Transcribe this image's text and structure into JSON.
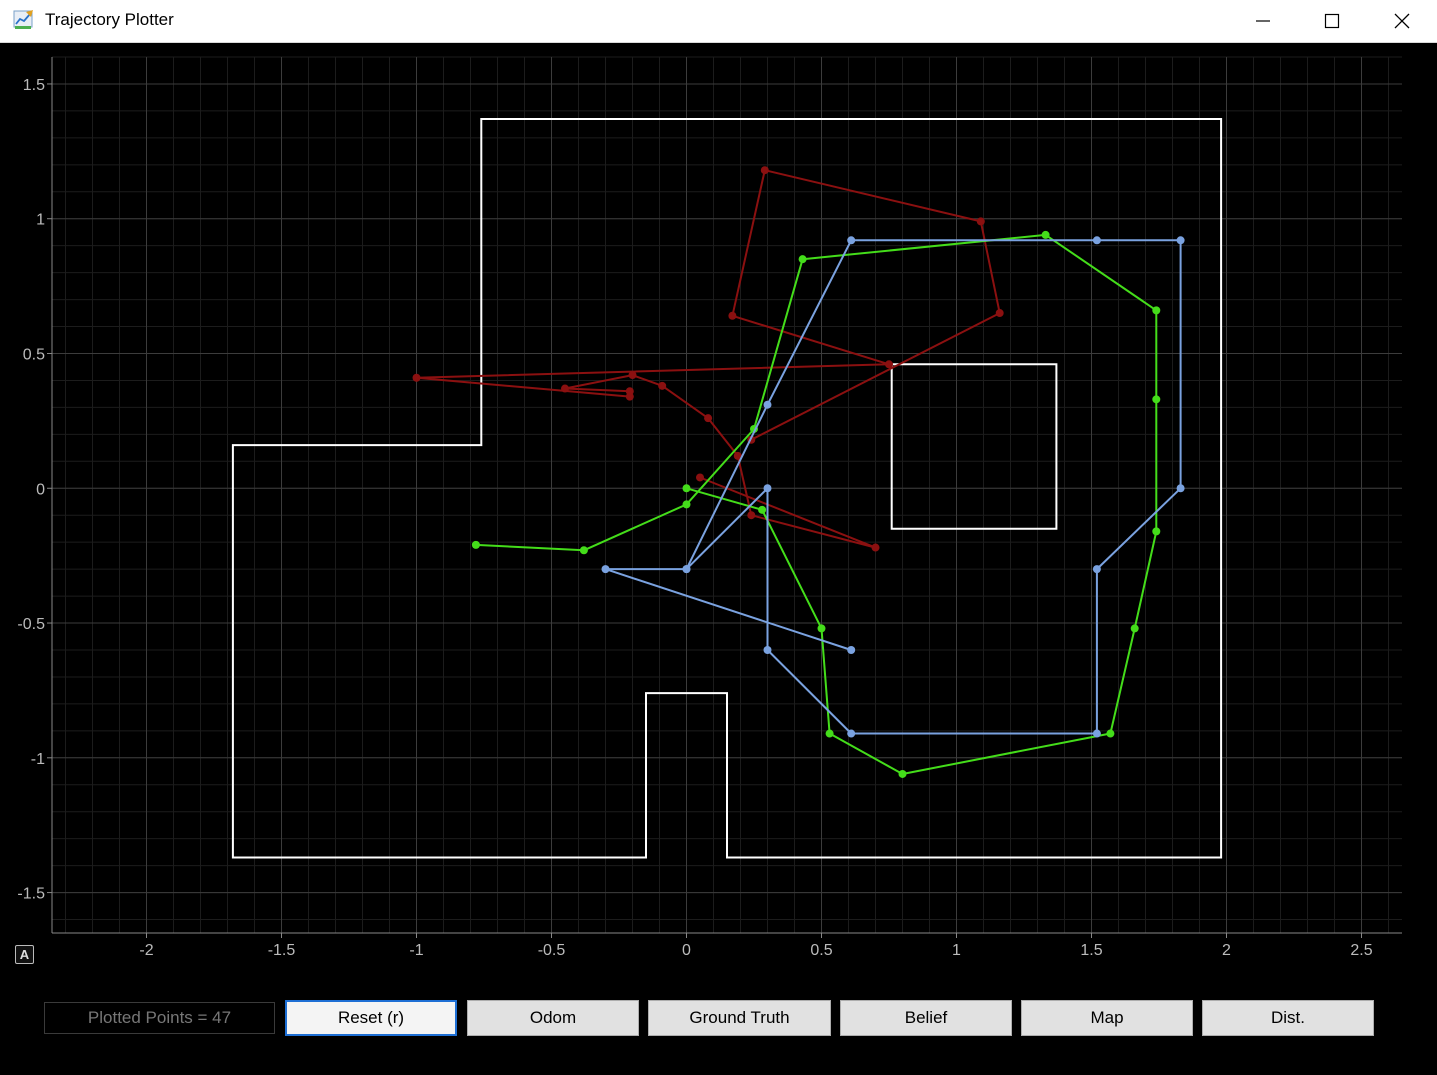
{
  "window": {
    "title": "Trajectory Plotter"
  },
  "toolbar": {
    "auto_label": "A",
    "status": "Plotted Points = 47",
    "buttons": [
      "Reset (r)",
      "Odom",
      "Ground Truth",
      "Belief",
      "Map",
      "Dist."
    ]
  },
  "colors": {
    "odom": "#8b1010",
    "ground_truth": "#44dd1a",
    "belief": "#7aa2e0",
    "map": "#ffffff",
    "background": "#000000"
  },
  "chart_data": {
    "type": "line",
    "xlim": [
      -2.35,
      2.65
    ],
    "ylim": [
      -1.65,
      1.6
    ],
    "x_ticks": [
      -2,
      -1.5,
      -1,
      -0.5,
      0,
      0.5,
      1,
      1.5,
      2,
      2.5
    ],
    "x_tick_labels": [
      "-2",
      "-1.5",
      "-1",
      "-0.5",
      "0",
      "0.5",
      "1",
      "1.5",
      "2",
      "2.5"
    ],
    "y_ticks": [
      1.5,
      1,
      0.5,
      0,
      -0.5,
      -1,
      -1.5
    ],
    "y_tick_labels": [
      "1.5",
      "1",
      "0.5",
      "0",
      "-0.5",
      "-1",
      "-1.5"
    ],
    "grid": true,
    "map_polygons": [
      [
        [
          -1.68,
          0.16
        ],
        [
          -0.76,
          0.16
        ],
        [
          -0.76,
          1.37
        ],
        [
          1.98,
          1.37
        ],
        [
          1.98,
          -1.37
        ],
        [
          0.15,
          -1.37
        ],
        [
          0.15,
          -0.76
        ],
        [
          -0.15,
          -0.76
        ],
        [
          -0.15,
          -1.37
        ],
        [
          -1.68,
          -1.37
        ]
      ],
      [
        [
          0.76,
          0.46
        ],
        [
          1.37,
          0.46
        ],
        [
          1.37,
          -0.15
        ],
        [
          0.76,
          -0.15
        ]
      ]
    ],
    "series": [
      {
        "key": "odom",
        "points": [
          [
            0.05,
            0.04
          ],
          [
            0.7,
            -0.22
          ],
          [
            0.24,
            -0.1
          ],
          [
            0.19,
            0.12
          ],
          [
            0.08,
            0.26
          ],
          [
            -0.09,
            0.38
          ],
          [
            -0.2,
            0.42
          ],
          [
            -0.45,
            0.37
          ],
          [
            -0.21,
            0.36
          ],
          [
            -0.21,
            0.34
          ],
          [
            -1.0,
            0.41
          ],
          [
            0.75,
            0.46
          ],
          [
            0.17,
            0.64
          ],
          [
            0.29,
            1.18
          ],
          [
            1.09,
            0.99
          ],
          [
            1.16,
            0.65
          ],
          [
            0.24,
            0.18
          ]
        ]
      },
      {
        "key": "ground_truth",
        "points": [
          [
            0,
            0
          ],
          [
            0.28,
            -0.08
          ],
          [
            0.5,
            -0.52
          ],
          [
            0.53,
            -0.91
          ],
          [
            0.8,
            -1.06
          ],
          [
            1.57,
            -0.91
          ],
          [
            1.66,
            -0.52
          ],
          [
            1.74,
            -0.16
          ],
          [
            1.74,
            0.33
          ],
          [
            1.74,
            0.66
          ],
          [
            1.33,
            0.94
          ],
          [
            0.43,
            0.85
          ],
          [
            0.25,
            0.22
          ],
          [
            0,
            -0.06
          ],
          [
            -0.38,
            -0.23
          ],
          [
            -0.78,
            -0.21
          ]
        ]
      },
      {
        "key": "belief",
        "points": [
          [
            0.61,
            -0.6
          ],
          [
            -0.3,
            -0.3
          ],
          [
            0,
            -0.3
          ],
          [
            0.3,
            0.31
          ],
          [
            0.61,
            0.92
          ],
          [
            1.52,
            0.92
          ],
          [
            1.83,
            0.92
          ],
          [
            1.83,
            0
          ],
          [
            1.52,
            -0.3
          ],
          [
            1.52,
            -0.91
          ],
          [
            0.61,
            -0.91
          ],
          [
            0.3,
            -0.6
          ],
          [
            0.3,
            0
          ],
          [
            0,
            -0.3
          ]
        ]
      }
    ]
  }
}
